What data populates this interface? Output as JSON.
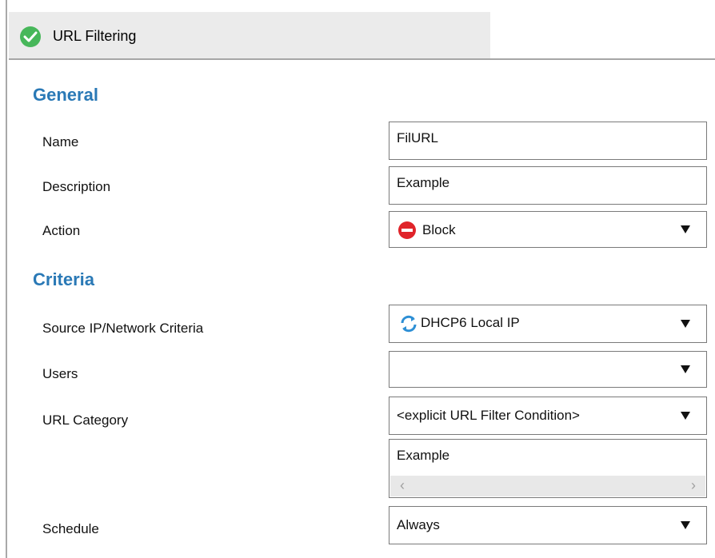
{
  "tab": {
    "title": "URL Filtering",
    "status_icon": "check-circle-icon"
  },
  "general": {
    "heading": "General",
    "name": {
      "label": "Name",
      "value": "FilURL"
    },
    "description": {
      "label": "Description",
      "value": "Example"
    },
    "action": {
      "label": "Action",
      "value": "Block",
      "icon": "block-icon"
    }
  },
  "criteria": {
    "heading": "Criteria",
    "source": {
      "label": "Source IP/Network Criteria",
      "value": "DHCP6 Local IP",
      "icon": "network-refresh-icon"
    },
    "users": {
      "label": "Users",
      "value": ""
    },
    "url_category": {
      "label": "URL Category",
      "value": "<explicit URL Filter Condition>",
      "list_items": [
        "Example"
      ]
    },
    "schedule": {
      "label": "Schedule",
      "value": "Always"
    }
  },
  "colors": {
    "section_heading": "#2a79b6",
    "check_green": "#47b75a",
    "block_red": "#e0242a"
  }
}
